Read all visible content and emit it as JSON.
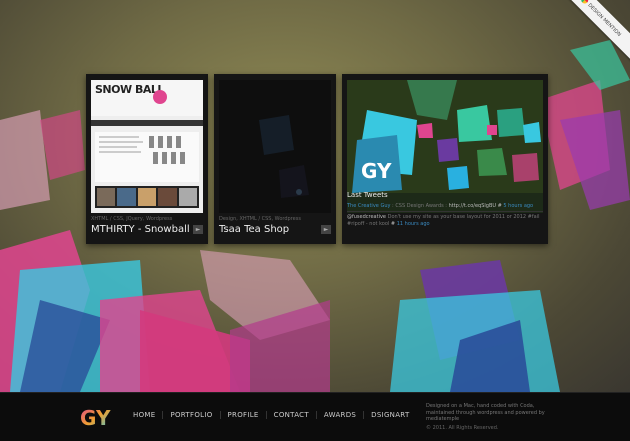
{
  "badge": {
    "label": "DESIGN MENTION"
  },
  "portfolio": [
    {
      "tags": "XHTML / CSS, JQuery, Wordpress",
      "title": "MTHIRTY - Snowball",
      "thumb_text": "SNOW BALL"
    },
    {
      "tags": "Design, XHTML / CSS, Wordpress",
      "title": "Tsaa Tea Shop"
    }
  ],
  "tweets": {
    "heading": "Last Tweets",
    "items": [
      {
        "source": "The Creative Guy",
        "text": ": CSS Design Awards :",
        "link": "http://t.co/eqSlgBU #",
        "time": "5 hours ago"
      },
      {
        "source": "@fusedcreative",
        "text": "Don't use my site as your base layout for 2011 or 2012 #fail #ripoff - not kool",
        "link": "#",
        "time": "11 hours ago"
      }
    ]
  },
  "footer": {
    "nav": [
      "HOME",
      "PORTFOLIO",
      "PROFILE",
      "CONTACT",
      "AWARDS",
      "DSIGNART"
    ],
    "credit": "Designed on a Mac, hand coded with Coda, maintained through wordpress and powered by mediatemple",
    "copyright": "© 2011. All Rights Reserved."
  },
  "colors": {
    "pink": "#e0458f",
    "cyan": "#39c8e0",
    "purple": "#6a3aa0",
    "footer_bg": "#0c0c0c"
  }
}
